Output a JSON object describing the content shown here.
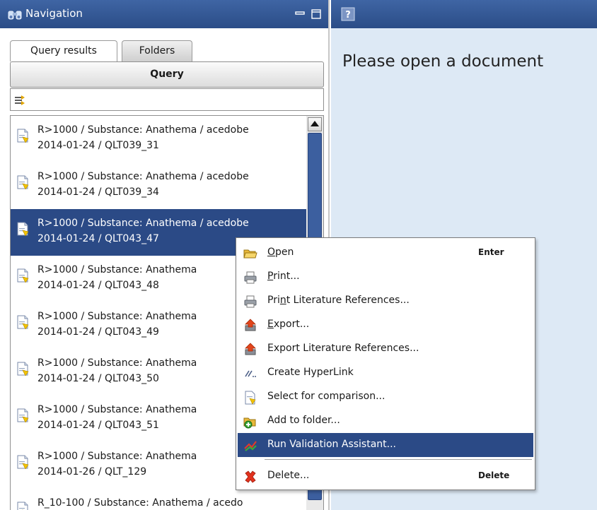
{
  "nav": {
    "title": "Navigation",
    "tabs": [
      {
        "label": "Query results",
        "active": true
      },
      {
        "label": "Folders",
        "active": false
      }
    ],
    "query_button": "Query",
    "results": [
      {
        "line1": "R>1000 / Substance: Anathema / acedobe",
        "line2": "2014-01-24 / QLT039_31",
        "selected": false
      },
      {
        "line1": "R>1000 / Substance: Anathema / acedobe",
        "line2": "2014-01-24 / QLT039_34",
        "selected": false
      },
      {
        "line1": "R>1000 / Substance: Anathema / acedobe",
        "line2": "2014-01-24 / QLT043_47",
        "selected": true
      },
      {
        "line1": "R>1000 / Substance: Anathema",
        "line2": "2014-01-24 / QLT043_48",
        "selected": false
      },
      {
        "line1": "R>1000 / Substance: Anathema",
        "line2": "2014-01-24 / QLT043_49",
        "selected": false
      },
      {
        "line1": "R>1000 / Substance: Anathema",
        "line2": "2014-01-24 / QLT043_50",
        "selected": false
      },
      {
        "line1": "R>1000 / Substance: Anathema",
        "line2": "2014-01-24 / QLT043_51",
        "selected": false
      },
      {
        "line1": "R>1000 / Substance: Anathema",
        "line2": "2014-01-26 / QLT_129",
        "selected": false
      },
      {
        "line1": "R_10-100 / Substance: Anathema / acedo",
        "line2": "",
        "selected": false
      }
    ]
  },
  "document": {
    "message": "Please open a document"
  },
  "context_menu": {
    "items": [
      {
        "pre": "",
        "mn": "O",
        "post": "pen",
        "shortcut": "Enter",
        "icon": "folder-open-icon"
      },
      {
        "pre": "",
        "mn": "P",
        "post": "rint...",
        "shortcut": "",
        "icon": "printer-icon"
      },
      {
        "pre": "Pri",
        "mn": "n",
        "post": "t Literature References...",
        "shortcut": "",
        "icon": "printer-icon"
      },
      {
        "pre": "",
        "mn": "E",
        "post": "xport...",
        "shortcut": "",
        "icon": "export-icon"
      },
      {
        "pre": "Export Literature References...",
        "mn": "",
        "post": "",
        "shortcut": "",
        "icon": "export-icon"
      },
      {
        "pre": "Create HyperLink",
        "mn": "",
        "post": "",
        "shortcut": "",
        "icon": "hyperlink-icon"
      },
      {
        "pre": "Select for comparison...",
        "mn": "",
        "post": "",
        "shortcut": "",
        "icon": "compare-document-icon"
      },
      {
        "pre": "Add to folder...",
        "mn": "",
        "post": "",
        "shortcut": "",
        "icon": "add-folder-icon"
      },
      {
        "pre": "Run Validation Assistant...",
        "mn": "",
        "post": "",
        "shortcut": "",
        "icon": "validation-icon"
      },
      {
        "pre": "Delete...",
        "mn": "",
        "post": "",
        "shortcut": "Delete",
        "icon": "delete-icon"
      }
    ]
  },
  "colors": {
    "titlebar": "#2b4d87",
    "selection": "#2b4a86",
    "document_background": "#dde9f5"
  }
}
